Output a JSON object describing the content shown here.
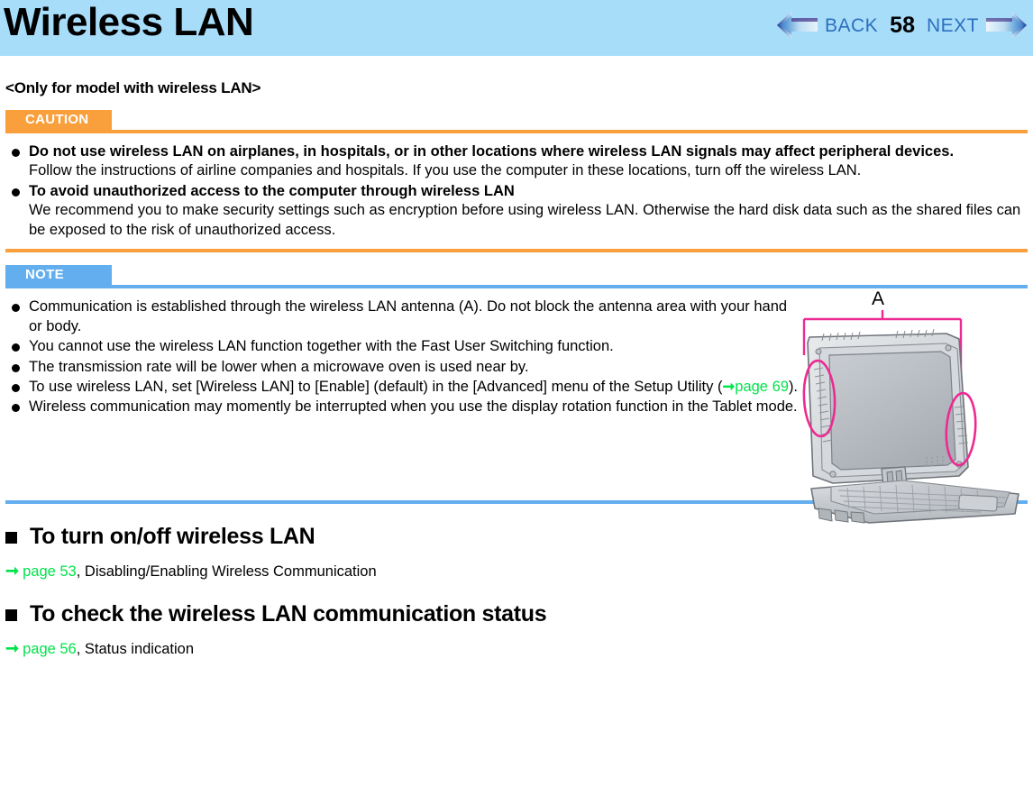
{
  "header": {
    "title": "Wireless LAN",
    "nav": {
      "back_label": "BACK",
      "page_number": "58",
      "next_label": "NEXT",
      "back_arrow_icon": "left-arrow-icon",
      "next_arrow_icon": "right-arrow-icon"
    },
    "background_color": "#a8ddfa",
    "link_color": "#2c6fbd"
  },
  "model_note": "<Only for model with wireless LAN>",
  "caution": {
    "badge_label": "CAUTION",
    "badge_color": "#f9a03c",
    "items": [
      {
        "bold": "Do not use wireless LAN on airplanes, in hospitals, or in other locations where wireless LAN signals may affect peripheral devices.",
        "body": "Follow the instructions of airline companies and hospitals. If you use the computer in these locations, turn off the wireless LAN."
      },
      {
        "bold": "To avoid unauthorized access to the computer through wireless LAN",
        "body": "We recommend you to make security settings such as encryption before using wireless LAN. Otherwise the hard disk data such as the shared files can be exposed to the risk of unauthorized access."
      }
    ]
  },
  "note": {
    "badge_label": "NOTE",
    "badge_color": "#63aeee",
    "items": [
      {
        "pre": "Communication is established through the wireless LAN antenna (A). Do not block the antenna area with your hand or body.",
        "link": "",
        "post": ""
      },
      {
        "pre": "You cannot use the wireless LAN function together with the Fast User Switching function.",
        "link": "",
        "post": ""
      },
      {
        "pre": "The transmission rate will be lower when a microwave oven is used near by.",
        "link": "",
        "post": ""
      },
      {
        "pre": "To use wireless LAN, set [Wireless LAN] to [Enable] (default) in the [Advanced] menu of the Setup Utility (",
        "link": "page 69",
        "post": ").",
        "arrow_icon": "right-arrow-green-icon"
      },
      {
        "pre": "Wireless communication may momently be interrupted when you use the display rotation function in the Tablet mode.",
        "link": "",
        "post": ""
      }
    ],
    "illustration": {
      "name": "laptop-antenna-illustration",
      "callout_label": "A",
      "highlight_color": "#ec2b92",
      "description": "Toughbook convertible laptop with wireless LAN antenna areas circled on both sides of the display"
    }
  },
  "sections": [
    {
      "heading": "To turn on/off wireless LAN",
      "link": "page 53",
      "link_suffix": ", Disabling/Enabling Wireless Communication",
      "arrow_icon": "right-arrow-green-icon"
    },
    {
      "heading": "To check the wireless LAN communication status",
      "link": "page 56",
      "link_suffix": ", Status indication",
      "arrow_icon": "right-arrow-green-icon"
    }
  ],
  "colors": {
    "link_green": "#00e34a",
    "caution_orange": "#f9a03c",
    "note_blue": "#63aeee",
    "header_blue": "#a8ddfa"
  }
}
